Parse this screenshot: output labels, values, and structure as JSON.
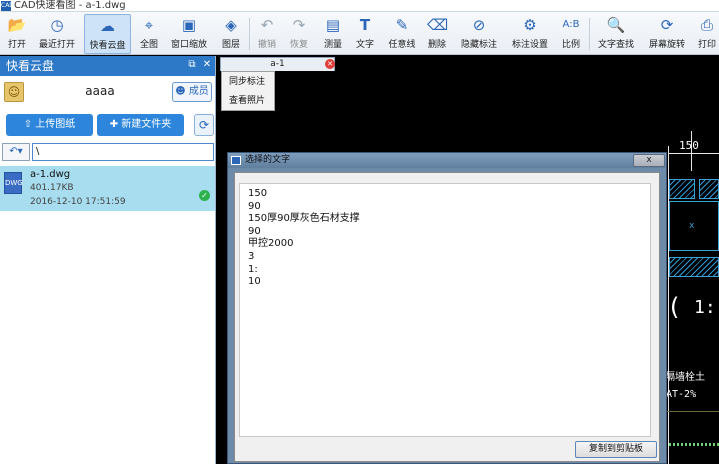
{
  "app": {
    "title": "CAD快速看图 - a-1.dwg",
    "icon": "CAD"
  },
  "toolbar": {
    "items": [
      {
        "label": "打开",
        "icon": "folder-icon"
      },
      {
        "label": "最近打开",
        "icon": "clock-icon"
      },
      {
        "label": "快看云盘",
        "icon": "cloud-icon"
      },
      {
        "label": "全图",
        "icon": "fullview-icon"
      },
      {
        "label": "窗口缩放",
        "icon": "zoom-window-icon"
      },
      {
        "label": "图层",
        "icon": "layers-icon"
      },
      {
        "label": "撤销",
        "icon": "undo-icon"
      },
      {
        "label": "恢复",
        "icon": "redo-icon"
      },
      {
        "label": "测量",
        "icon": "ruler-icon"
      },
      {
        "label": "文字",
        "icon": "text-icon"
      },
      {
        "label": "任意线",
        "icon": "pen-icon"
      },
      {
        "label": "删除",
        "icon": "eraser-icon"
      },
      {
        "label": "隐藏标注",
        "icon": "eye-slash-icon"
      },
      {
        "label": "标注设置",
        "icon": "annotation-settings-icon"
      },
      {
        "label": "比例",
        "icon": "scale-icon"
      },
      {
        "label": "文字查找",
        "icon": "text-search-icon"
      },
      {
        "label": "屏幕旋转",
        "icon": "rotate-screen-icon"
      },
      {
        "label": "打印",
        "icon": "printer-icon"
      }
    ]
  },
  "panel": {
    "title": "快看云盘",
    "username": "aaaa",
    "member_label": "成员",
    "upload_label": "上传图纸",
    "new_folder_label": "新建文件夹",
    "path": "\\",
    "files": [
      {
        "name": "a-1.dwg",
        "size": "401.17KB",
        "date": "2016-12-10 17:51:59",
        "status": "synced"
      }
    ]
  },
  "drawing": {
    "tab_label": "a-1",
    "context_menu": [
      "同步标注",
      "查看照片"
    ],
    "labels": [
      "150",
      "1:",
      "隔墙栓土",
      "AT-2%"
    ]
  },
  "dialog": {
    "title": "选择的文字",
    "lines": [
      "150",
      "90",
      "150厚90厚灰色石材支撑",
      "90",
      "甲控2000",
      "3",
      "1:",
      "10"
    ],
    "copy_label": "复制到剪贴板",
    "close_label": "x"
  },
  "colors": {
    "accent": "#2d86dc",
    "panel_header": "#2d79c7",
    "selected_row": "#a7ddee",
    "canvas": "#000000",
    "hatch": "#2c9ad8"
  }
}
